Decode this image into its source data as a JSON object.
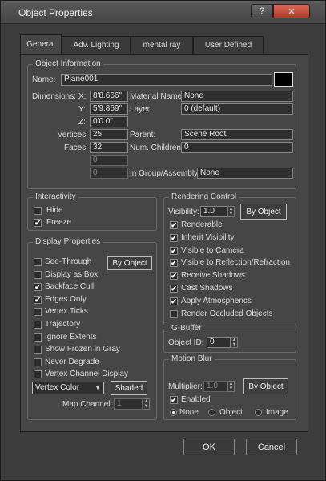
{
  "window": {
    "title": "Object Properties",
    "help_label": "?",
    "close_label": "✕"
  },
  "tabs": [
    {
      "label": "General"
    },
    {
      "label": "Adv. Lighting"
    },
    {
      "label": "mental ray"
    },
    {
      "label": "User Defined"
    }
  ],
  "object_info": {
    "group_label": "Object Information",
    "name_label": "Name:",
    "name_value": "Plane001",
    "dimensions_label": "Dimensions:",
    "x_label": "X:",
    "x_value": "8'8.666\"",
    "y_label": "Y:",
    "y_value": "5'9.869\"",
    "z_label": "Z:",
    "z_value": "0'0.0\"",
    "vertices_label": "Vertices:",
    "vertices_value": "25",
    "faces_label": "Faces:",
    "faces_value": "32",
    "extra1_value": "0",
    "extra2_value": "0",
    "material_label": "Material Name:",
    "material_value": "None",
    "layer_label": "Layer:",
    "layer_value": "0 (default)",
    "parent_label": "Parent:",
    "parent_value": "Scene Root",
    "children_label": "Num. Children:",
    "children_value": "0",
    "assembly_label": "In Group/Assembly:",
    "assembly_value": "None"
  },
  "interactivity": {
    "group_label": "Interactivity",
    "hide_label": "Hide",
    "freeze_label": "Freeze"
  },
  "display": {
    "group_label": "Display Properties",
    "by_object_label": "By Object",
    "items": [
      {
        "label": "See-Through",
        "checked": false
      },
      {
        "label": "Display as Box",
        "checked": false
      },
      {
        "label": "Backface Cull",
        "checked": true
      },
      {
        "label": "Edges Only",
        "checked": true
      },
      {
        "label": "Vertex Ticks",
        "checked": false
      },
      {
        "label": "Trajectory",
        "checked": false
      },
      {
        "label": "Ignore Extents",
        "checked": false
      },
      {
        "label": "Show Frozen in Gray",
        "checked": false
      },
      {
        "label": "Never Degrade",
        "checked": false
      },
      {
        "label": "Vertex Channel Display",
        "checked": false
      }
    ],
    "vertex_color_value": "Vertex Color",
    "shaded_label": "Shaded",
    "map_channel_label": "Map Channel:",
    "map_channel_value": "1"
  },
  "rendering": {
    "group_label": "Rendering Control",
    "visibility_label": "Visibility:",
    "visibility_value": "1.0",
    "by_object_label": "By Object",
    "items": [
      {
        "label": "Renderable",
        "checked": true
      },
      {
        "label": "Inherit Visibility",
        "checked": true
      },
      {
        "label": "Visible to Camera",
        "checked": true
      },
      {
        "label": "Visible to Reflection/Refraction",
        "checked": true
      },
      {
        "label": "Receive Shadows",
        "checked": true
      },
      {
        "label": "Cast Shadows",
        "checked": true
      },
      {
        "label": "Apply Atmospherics",
        "checked": true
      },
      {
        "label": "Render Occluded Objects",
        "checked": false
      }
    ]
  },
  "gbuffer": {
    "group_label": "G-Buffer",
    "object_id_label": "Object ID:",
    "object_id_value": "0"
  },
  "motion_blur": {
    "group_label": "Motion Blur",
    "multiplier_label": "Multiplier:",
    "multiplier_value": "1.0",
    "by_object_label": "By Object",
    "enabled_label": "Enabled",
    "none_label": "None",
    "object_label": "Object",
    "image_label": "Image"
  },
  "footer": {
    "ok_label": "OK",
    "cancel_label": "Cancel"
  },
  "check_glyph": "✔",
  "spin_up": "▲",
  "spin_down": "▼",
  "dropdown_glyph": "▼"
}
